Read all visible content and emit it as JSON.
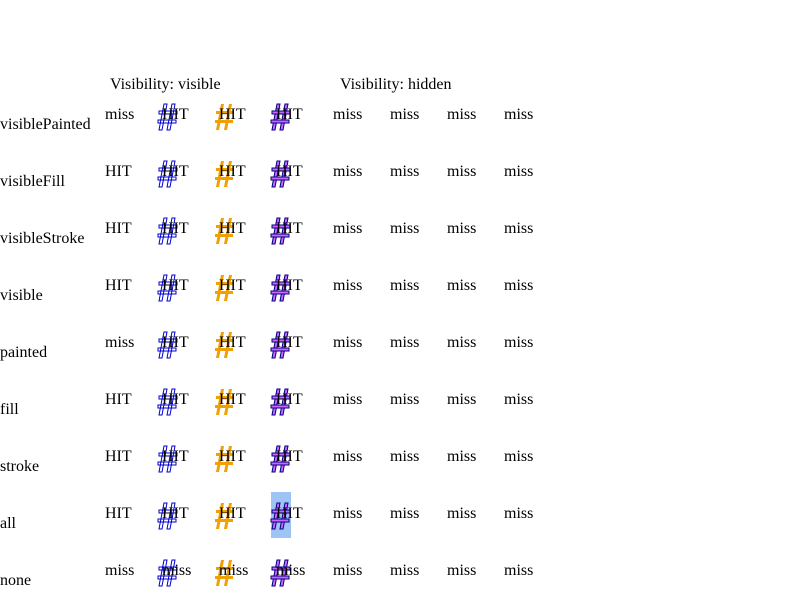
{
  "headings": {
    "visible": "Visibility: visible",
    "hidden": "Visibility: hidden"
  },
  "rows": [
    {
      "label": "visiblePainted",
      "cells": [
        "miss",
        "HIT",
        "HIT",
        "HIT",
        "miss",
        "miss",
        "miss",
        "miss"
      ]
    },
    {
      "label": "visibleFill",
      "cells": [
        "HIT",
        "HIT",
        "HIT",
        "HIT",
        "miss",
        "miss",
        "miss",
        "miss"
      ]
    },
    {
      "label": "visibleStroke",
      "cells": [
        "HIT",
        "HIT",
        "HIT",
        "HIT",
        "miss",
        "miss",
        "miss",
        "miss"
      ]
    },
    {
      "label": "visible",
      "cells": [
        "HIT",
        "HIT",
        "HIT",
        "HIT",
        "miss",
        "miss",
        "miss",
        "miss"
      ]
    },
    {
      "label": "painted",
      "cells": [
        "miss",
        "HIT",
        "HIT",
        "HIT",
        "miss",
        "miss",
        "miss",
        "miss"
      ]
    },
    {
      "label": "fill",
      "cells": [
        "HIT",
        "HIT",
        "HIT",
        "HIT",
        "miss",
        "miss",
        "miss",
        "miss"
      ]
    },
    {
      "label": "stroke",
      "cells": [
        "HIT",
        "HIT",
        "HIT",
        "HIT",
        "miss",
        "miss",
        "miss",
        "miss"
      ]
    },
    {
      "label": "all",
      "cells": [
        "HIT",
        "HIT",
        "HIT",
        "HIT",
        "miss",
        "miss",
        "miss",
        "miss"
      ]
    },
    {
      "label": "none",
      "cells": [
        "miss",
        "miss",
        "miss",
        "miss",
        "miss",
        "miss",
        "miss",
        "miss"
      ]
    }
  ],
  "glyph_columns": [
    {
      "icon": "hash-outline-blue-icon",
      "fill": "none",
      "stroke": "#0000cc"
    },
    {
      "icon": "hash-filled-orange-icon",
      "fill": "#f0a000",
      "stroke": "none"
    },
    {
      "icon": "hash-purple-outline-icon",
      "fill": "#cc66ff",
      "stroke": "#000080"
    }
  ],
  "colors": {
    "selection": "#9ec4f5",
    "blue_stroke": "#0000cc",
    "orange_fill": "#f0a000",
    "purple_fill": "#cc66ff",
    "navy_stroke": "#000080"
  },
  "selected_cell": {
    "row": 7,
    "column": 3
  }
}
